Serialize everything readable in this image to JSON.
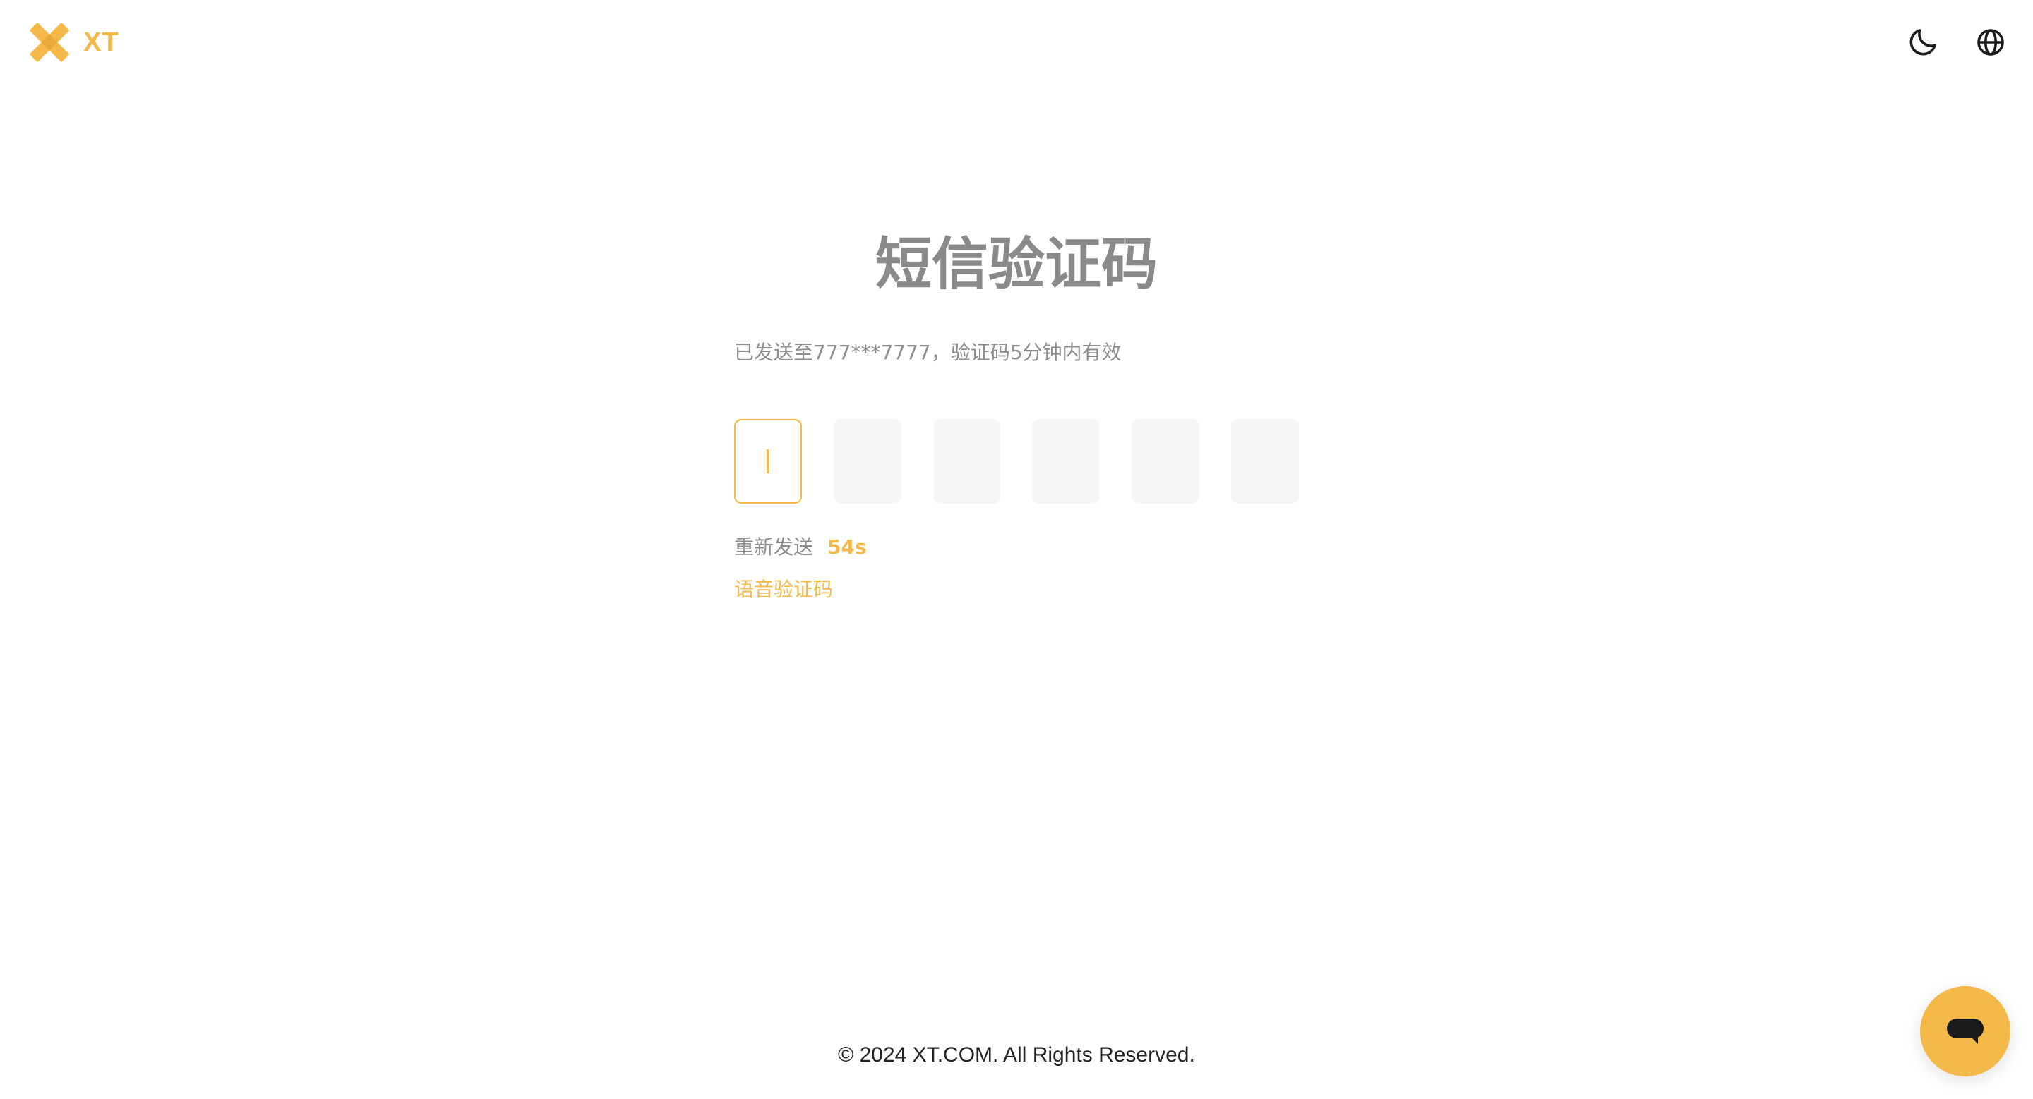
{
  "brand": {
    "name": "XT",
    "accent_color": "#F5B94A"
  },
  "header": {
    "theme_toggle_icon": "moon-icon",
    "language_icon": "globe-icon"
  },
  "verification": {
    "title": "短信验证码",
    "subtitle": "已发送至777***7777，验证码5分钟内有效",
    "code_boxes": [
      "",
      "",
      "",
      "",
      "",
      ""
    ],
    "active_index": 0,
    "resend_label": "重新发送",
    "countdown": "54s",
    "voice_code_link": "语音验证码"
  },
  "footer": {
    "copyright": "© 2024 XT.COM. All Rights Reserved."
  },
  "support": {
    "chat_icon": "chat-bubble-icon"
  }
}
